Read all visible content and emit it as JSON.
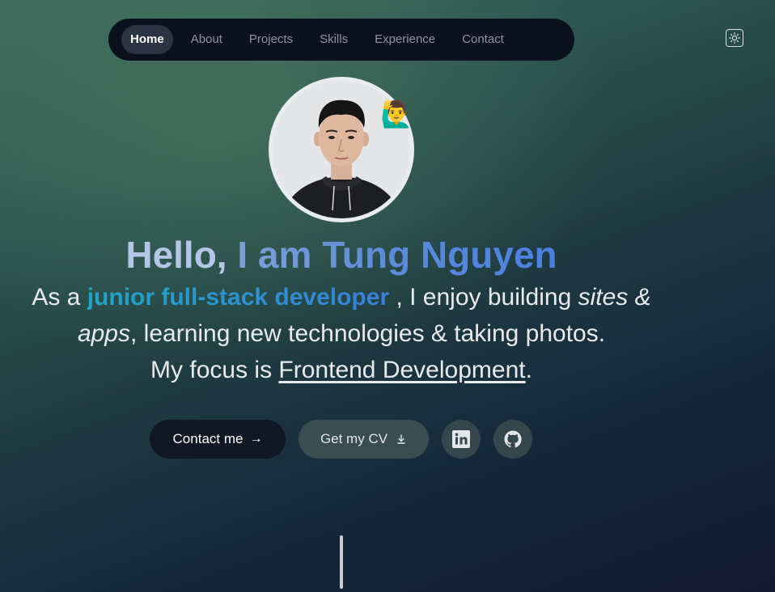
{
  "nav": {
    "items": [
      {
        "label": "Home",
        "active": true
      },
      {
        "label": "About",
        "active": false
      },
      {
        "label": "Projects",
        "active": false
      },
      {
        "label": "Skills",
        "active": false
      },
      {
        "label": "Experience",
        "active": false
      },
      {
        "label": "Contact",
        "active": false
      }
    ]
  },
  "theme_toggle": {
    "icon": "sun-icon"
  },
  "hero": {
    "avatar_emoji": "🙋‍♂️",
    "greeting": "Hello,",
    "name": "I am Tung Nguyen",
    "intro_prefix": "As a",
    "role": "junior full-stack developer",
    "intro_mid": ", I enjoy building",
    "intro_em": "sites & apps",
    "intro_rest": ", learning new technologies & taking photos.",
    "focus_prefix": "My focus is",
    "focus": "Frontend Development",
    "focus_suffix": "."
  },
  "actions": {
    "contact_label": "Contact me",
    "contact_icon": "arrow-right-icon",
    "cv_label": "Get my CV",
    "cv_icon": "download-icon",
    "linkedin_icon": "linkedin-icon",
    "github_icon": "github-icon"
  },
  "colors": {
    "nav_bg": "#0a111c",
    "accent_name": "#5b8ad8",
    "accent_role": "#1ea6c8",
    "contact_btn": "#101826"
  }
}
